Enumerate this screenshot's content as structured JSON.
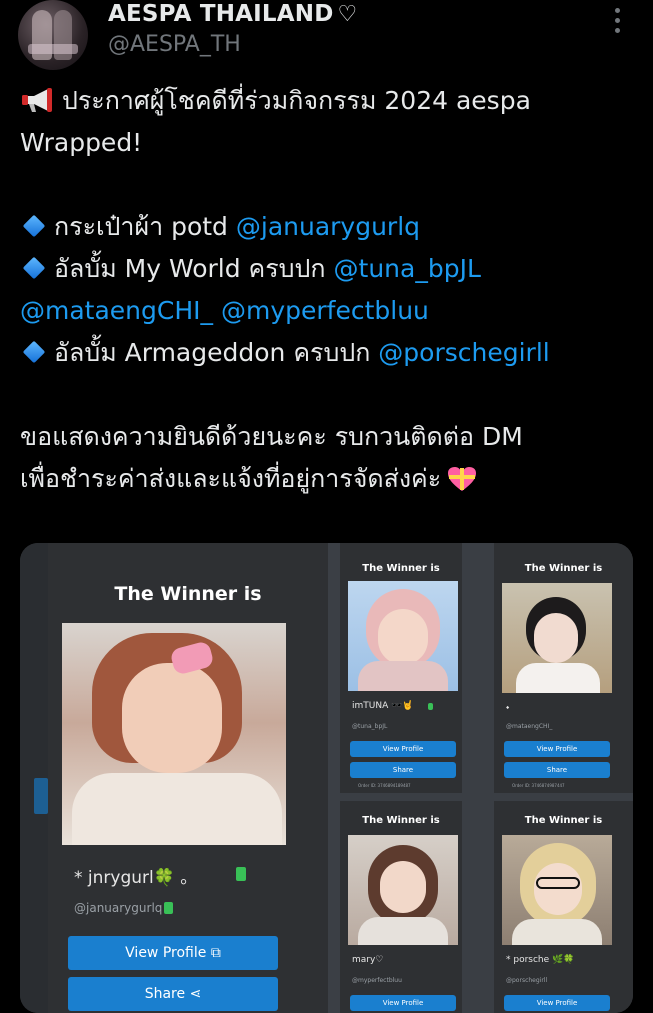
{
  "author": {
    "display_name": "AESPA THAILAND",
    "verified_heart": "♡",
    "handle": "@AESPA_TH"
  },
  "tweet": {
    "line1_text": "ประกาศผู้โชคดีที่ร่วมกิจกรรม 2024 aespa",
    "line2_text": "Wrapped!",
    "item1_text": "กระเป๋าผ้า potd ",
    "item1_mention": "@januarygurlq",
    "item2_text": "อัลบั้ม My World ครบปก ",
    "item2_mention": "@tuna_bpJL",
    "item2_mention2": "@mataengCHI_",
    "item2_mention3": "@myperfectbluu",
    "item3_text": "อัลบั้ม Armageddon ครบปก ",
    "item3_mention": "@porschegirll",
    "closing_line1": "ขอแสดงความยินดีด้วยนะคะ รบกวนติดต่อ DM",
    "closing_line2": "เพื่อชำระค่าส่งและแจ้งที่อยู่การจัดส่งค่ะ"
  },
  "media": {
    "cards": [
      {
        "heading": "The Winner is",
        "name": "* jnrygurl🍀 。",
        "handle": "@januarygurlq",
        "view": "View Profile",
        "share": "Share"
      },
      {
        "heading": "The Winner is",
        "name": "imTUNA 🕶️🤘",
        "handle": "@tuna_bpJL",
        "view": "View Profile",
        "share": "Share",
        "order": "Order ID: 3746894189487"
      },
      {
        "heading": "The Winner is",
        "name": "⬩",
        "handle": "@mataengCHI_",
        "view": "View Profile",
        "share": "Share",
        "order": "Order ID: 3746874987447"
      },
      {
        "heading": "The Winner is",
        "name": "mary♡",
        "handle": "@myperfectbluu",
        "view": "View Profile"
      },
      {
        "heading": "The Winner is",
        "name": "* porsche 🌿🍀",
        "handle": "@porschegirll",
        "view": "View Profile"
      }
    ]
  },
  "icons": [
    "megaphone-icon",
    "diamond-bullet-icon",
    "gift-heart-icon",
    "more-icon",
    "clipboard-icon",
    "external-link-icon",
    "share-icon"
  ],
  "colors": {
    "link": "#1d9bf0",
    "button": "#1a7fcf",
    "card_bg": "#2e3033"
  }
}
